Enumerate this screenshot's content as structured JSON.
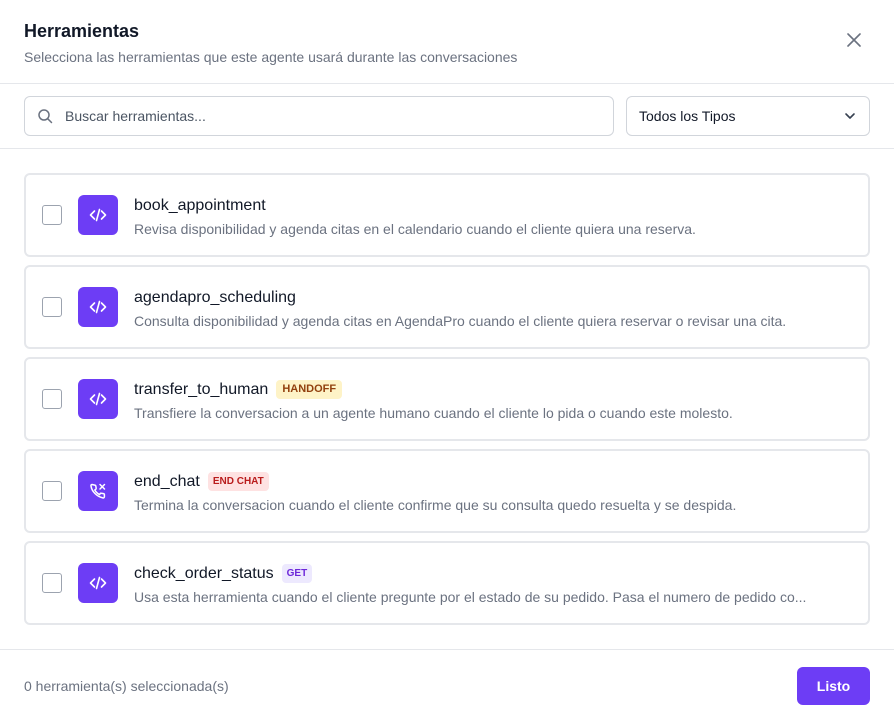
{
  "header": {
    "title": "Herramientas",
    "subtitle": "Selecciona las herramientas que este agente usará durante las conversaciones",
    "close_icon": "close-icon"
  },
  "filters": {
    "search_placeholder": "Buscar herramientas...",
    "search_value": "",
    "search_icon": "search-icon",
    "type_select_value": "Todos los Tipos",
    "type_select_icon": "chevron-down-icon"
  },
  "tools": [
    {
      "name": "book_appointment",
      "badge": "",
      "icon": "code-icon",
      "description": "Revisa disponibilidad y agenda citas en el calendario cuando el cliente quiera una reserva.",
      "checked": false
    },
    {
      "name": "agendapro_scheduling",
      "badge": "",
      "icon": "code-icon",
      "description": "Consulta disponibilidad y agenda citas en AgendaPro cuando el cliente quiera reservar o revisar una cita.",
      "checked": false
    },
    {
      "name": "transfer_to_human",
      "badge": "HANDOFF",
      "icon": "code-icon",
      "description": "Transfiere la conversacion a un agente humano cuando el cliente lo pida o cuando este molesto.",
      "checked": false
    },
    {
      "name": "end_chat",
      "badge": "END CHAT",
      "icon": "phone-off-icon",
      "description": "Termina la conversacion cuando el cliente confirme que su consulta quedo resuelta y se despida.",
      "checked": false
    },
    {
      "name": "check_order_status",
      "badge": "GET",
      "icon": "code-icon",
      "description": "Usa esta herramienta cuando el cliente pregunte por el estado de su pedido. Pasa el numero de pedido co...",
      "checked": false
    }
  ],
  "footer": {
    "selected_count": "0 herramienta(s) seleccionada(s)",
    "done_label": "Listo"
  },
  "colors": {
    "accent": "#6d3df5",
    "handoff_badge_bg": "#fef3c7",
    "endchat_badge_bg": "#fee2e2",
    "get_badge_bg": "#ede9fe"
  }
}
